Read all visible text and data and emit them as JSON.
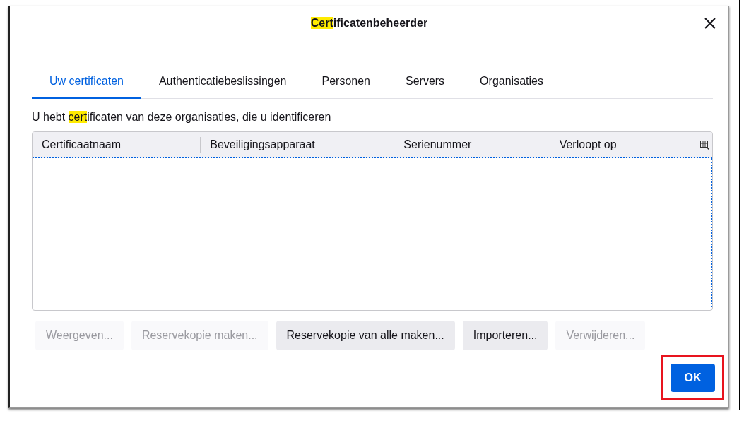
{
  "window": {
    "title": {
      "highlighted": "Cert",
      "rest": "ificatenbeheerder"
    }
  },
  "tabs": [
    {
      "label": "Uw certificaten",
      "selected": true
    },
    {
      "label": "Authenticatiebeslissingen",
      "selected": false
    },
    {
      "label": "Personen",
      "selected": false
    },
    {
      "label": "Servers",
      "selected": false
    },
    {
      "label": "Organisaties",
      "selected": false
    }
  ],
  "description": {
    "before": "U hebt ",
    "highlighted": "cert",
    "after": "ificaten van deze organisaties, die u identificeren"
  },
  "table": {
    "columns": [
      "Certificaatnaam",
      "Beveiligingsapparaat",
      "Serienummer",
      "Verloopt op"
    ]
  },
  "buttons": [
    {
      "key": "W",
      "after": "eergeven...",
      "disabled": true
    },
    {
      "key": "R",
      "after": "eservekopie maken...",
      "disabled": true
    },
    {
      "before": "Reserve",
      "key": "k",
      "after": "opie van alle maken...",
      "disabled": false
    },
    {
      "before": "I",
      "key": "m",
      "after": "porteren...",
      "disabled": false
    },
    {
      "key": "V",
      "after": "erwijderen...",
      "disabled": true
    }
  ],
  "ok_button": {
    "label": "OK",
    "highlighted": true
  }
}
